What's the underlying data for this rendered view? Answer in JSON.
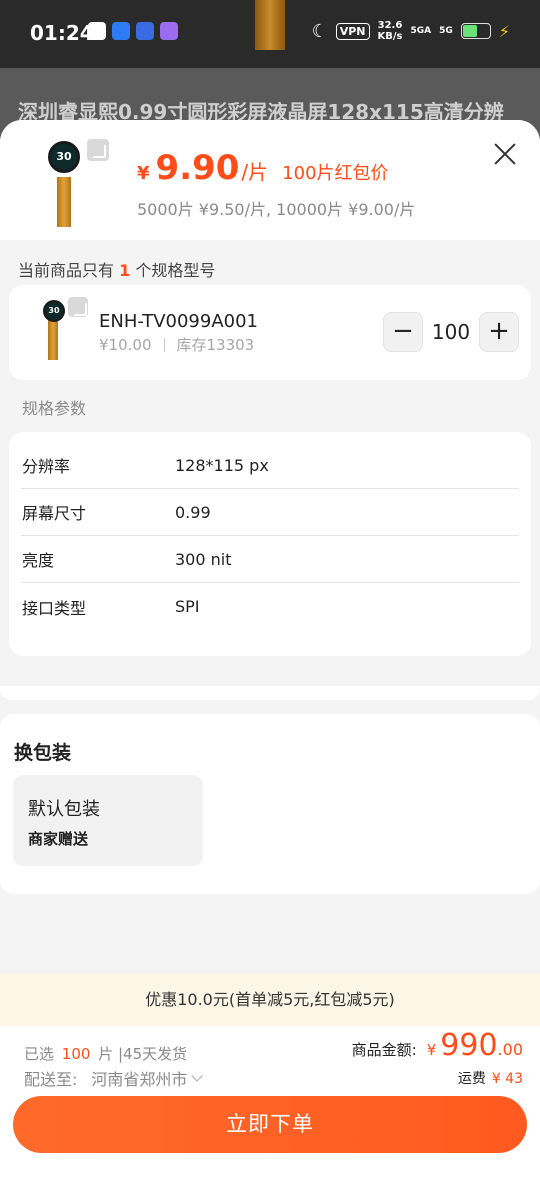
{
  "status_bar": {
    "time": "01:24",
    "vpn": "VPN",
    "speed_value": "32.6",
    "speed_unit": "KB/s",
    "signal_1": "5GA",
    "signal_2": "5G"
  },
  "background": {
    "title": "深圳睿显熙0.99寸圆形彩屏液晶屏128x115高清分辨"
  },
  "product": {
    "price_currency": "¥",
    "price": "9.90",
    "price_unit": "/片",
    "promo": "100片红包价",
    "tier_prices": "5000片 ¥9.50/片, 10000片 ¥9.00/片",
    "thumb_label": "30"
  },
  "spec_notice": {
    "prefix": "当前商品只有",
    "count": "1",
    "suffix": "个规格型号"
  },
  "sku": {
    "name": "ENH-TV0099A001",
    "price": "¥10.00",
    "stock": "库存13303",
    "quantity": "100",
    "minus": "−",
    "plus": "+",
    "thumb_label": "30"
  },
  "params_section": {
    "label": "规格参数",
    "rows": [
      {
        "key": "分辨率",
        "value": "128*115 px"
      },
      {
        "key": "屏幕尺寸",
        "value": "0.99"
      },
      {
        "key": "亮度",
        "value": "300 nit"
      },
      {
        "key": "接口类型",
        "value": "SPI"
      }
    ]
  },
  "packaging": {
    "title": "换包装",
    "option_name": "默认包装",
    "option_sub": "商家赠送"
  },
  "discount": {
    "text": "优惠10.0元(首单减5元,红包减5元)"
  },
  "footer": {
    "selected_prefix": "已选",
    "selected_count": "100",
    "selected_suffix": "片 |45天发货",
    "ship_label": "配送至:",
    "ship_address": "河南省郑州市",
    "total_label": "商品金额:",
    "total_currency": "¥",
    "total_int": "990",
    "total_dec": ".00",
    "freight_label": "运费",
    "freight_value": "¥ 43",
    "order_button": "立即下单"
  },
  "colors": {
    "accent": "#ff4d1a",
    "button": "#ff5a1f",
    "discount_bg": "#fdf5e6"
  }
}
